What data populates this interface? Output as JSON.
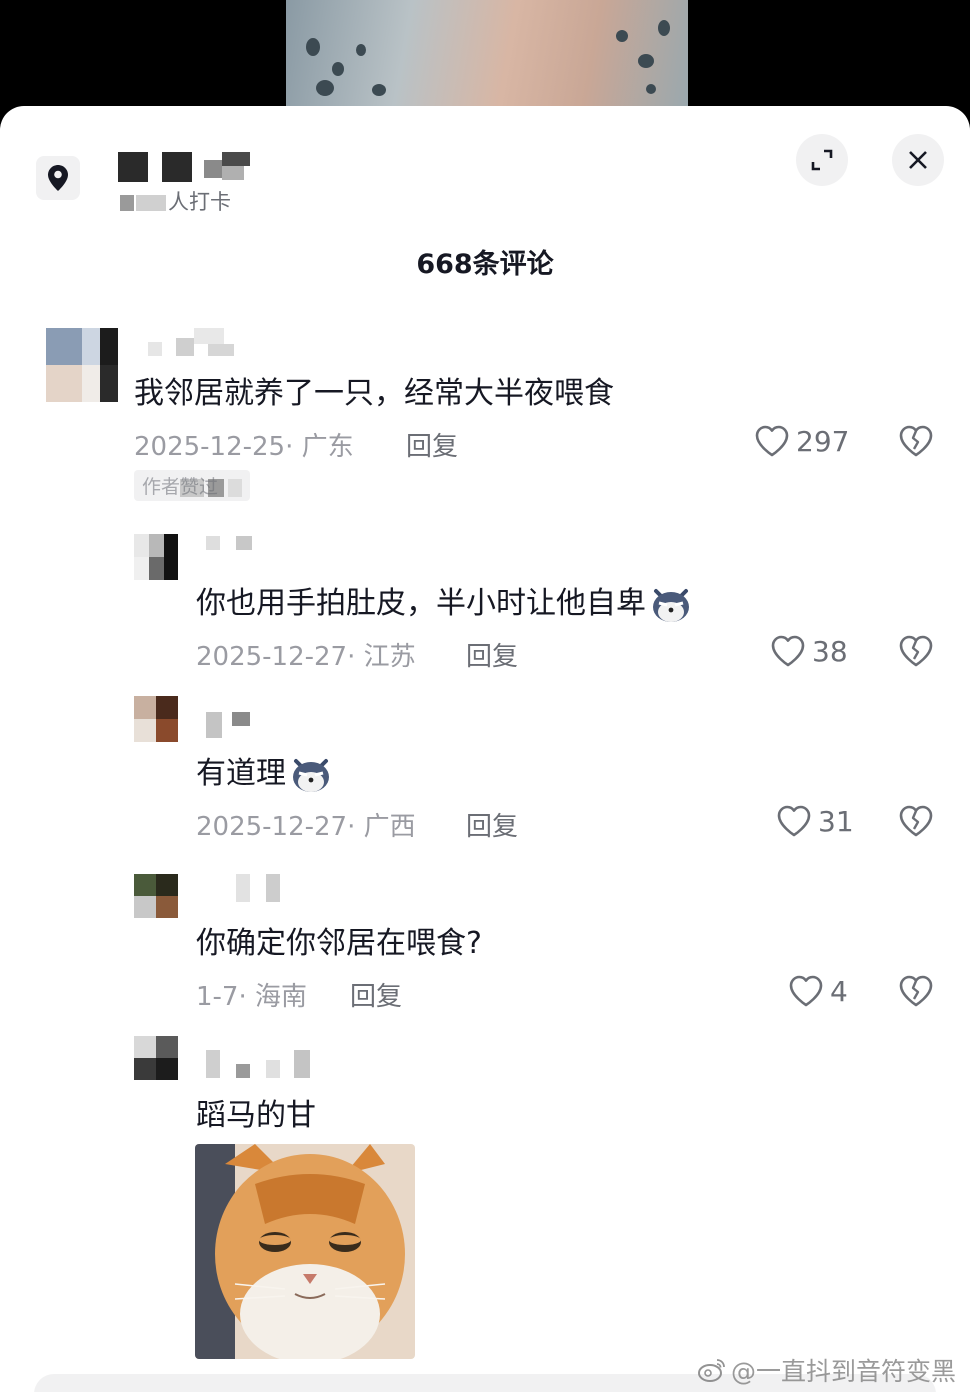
{
  "header": {
    "location_subtitle": "人打卡",
    "expand_icon": "expand-icon",
    "close_icon": "close-icon"
  },
  "comment_count": "668条评论",
  "comments": [
    {
      "text": "我邻居就养了一只，经常大半夜喂食",
      "date": "2025-12-25",
      "region": "广东",
      "reply_label": "回复",
      "likes": "297",
      "author_tag": "作者赞过"
    },
    {
      "text": "你也用手拍肚皮，半小时让他自卑",
      "date": "2025-12-27",
      "region": "江苏",
      "reply_label": "回复",
      "likes": "38"
    },
    {
      "text": "有道理",
      "date": "2025-12-27",
      "region": "广西",
      "reply_label": "回复",
      "likes": "31"
    },
    {
      "text": "你确定你邻居在喂食?",
      "date": "1-7",
      "region": "海南",
      "reply_label": "回复",
      "likes": "4"
    },
    {
      "text": "蹈马的甘"
    }
  ],
  "watermark": "@一直抖到音符变黑",
  "colors": {
    "text_primary": "#161823",
    "text_secondary": "#9a9ba2",
    "pill_bg": "#f1f1f2"
  }
}
